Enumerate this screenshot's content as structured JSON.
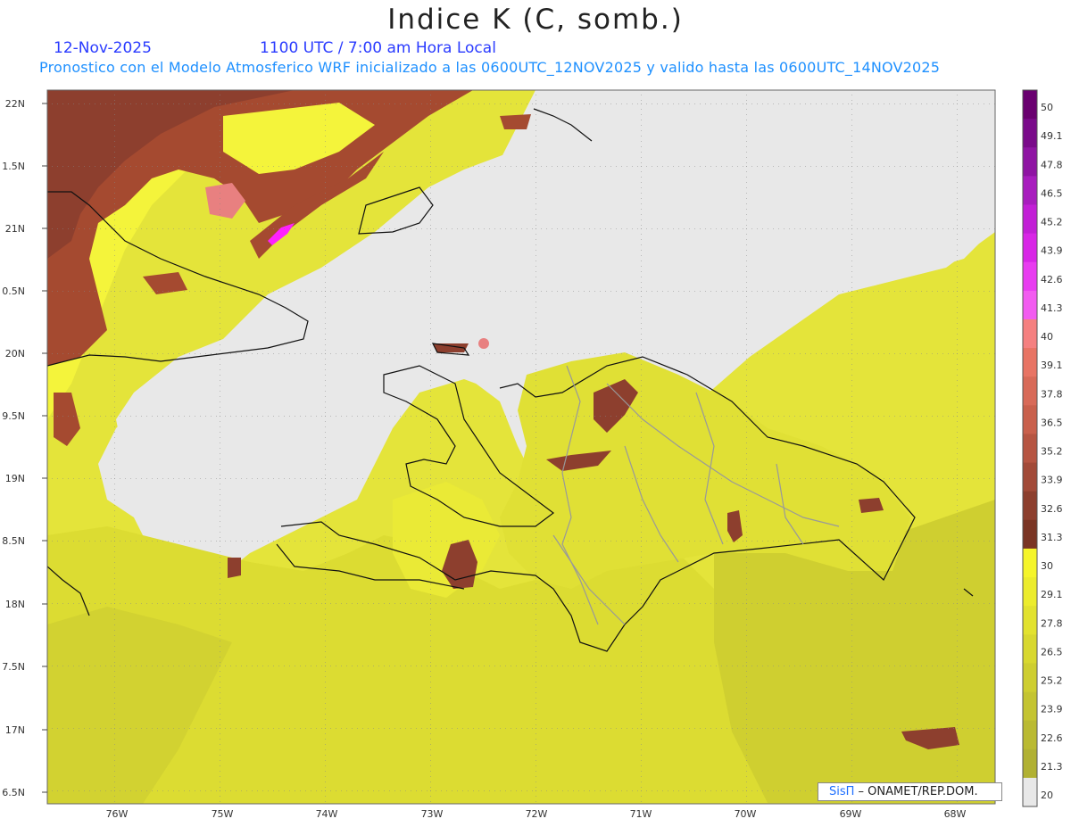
{
  "title": "Indice K (C, somb.)",
  "date": "12-Nov-2025",
  "time": "1100 UTC / 7:00 am Hora Local",
  "forecast_note": "Pronostico con el Modelo Atmosferico WRF inicializado a las 0600UTC_12NOV2025 y valido hasta las  0600UTC_14NOV2025",
  "lat_labels": [
    "22N",
    "1.5N",
    "21N",
    "0.5N",
    "20N",
    "9.5N",
    "19N",
    "8.5N",
    "18N",
    "7.5N",
    "17N",
    "6.5N"
  ],
  "lon_labels": [
    "76W",
    "75W",
    "74W",
    "73W",
    "72W",
    "71W",
    "70W",
    "69W",
    "68W"
  ],
  "colorbar": {
    "labels": [
      "50",
      "49.1",
      "47.8",
      "46.5",
      "45.2",
      "43.9",
      "42.6",
      "41.3",
      "40",
      "39.1",
      "37.8",
      "36.5",
      "35.2",
      "33.9",
      "32.6",
      "31.3",
      "30",
      "29.1",
      "27.8",
      "26.5",
      "25.2",
      "23.9",
      "22.6",
      "21.3",
      "20"
    ],
    "colors": [
      "#6a0070",
      "#7a0a8a",
      "#8f14a3",
      "#a81dbe",
      "#c21fd6",
      "#d826e6",
      "#e83cf0",
      "#f25cf0",
      "#f58080",
      "#e87464",
      "#d86a58",
      "#c9604c",
      "#b65542",
      "#a24a38",
      "#8d3f2e",
      "#7a3524",
      "#f5f52a",
      "#ecec2c",
      "#e2e22e",
      "#d8d82f",
      "#cece30",
      "#c4c431",
      "#baba32",
      "#b1b133",
      "#e8e8e8"
    ]
  },
  "credit": {
    "brand": "SisΠ",
    "org": " – ONAMET/REP.DOM."
  },
  "colors": {
    "land_ocean_no_data": "#e8e8e8",
    "low": "#c8c832",
    "mid": "#e6e63a",
    "high": "#f7f73a",
    "hot": "#a54a30",
    "very_hot": "#e88080",
    "extreme": "#ff20ff"
  }
}
